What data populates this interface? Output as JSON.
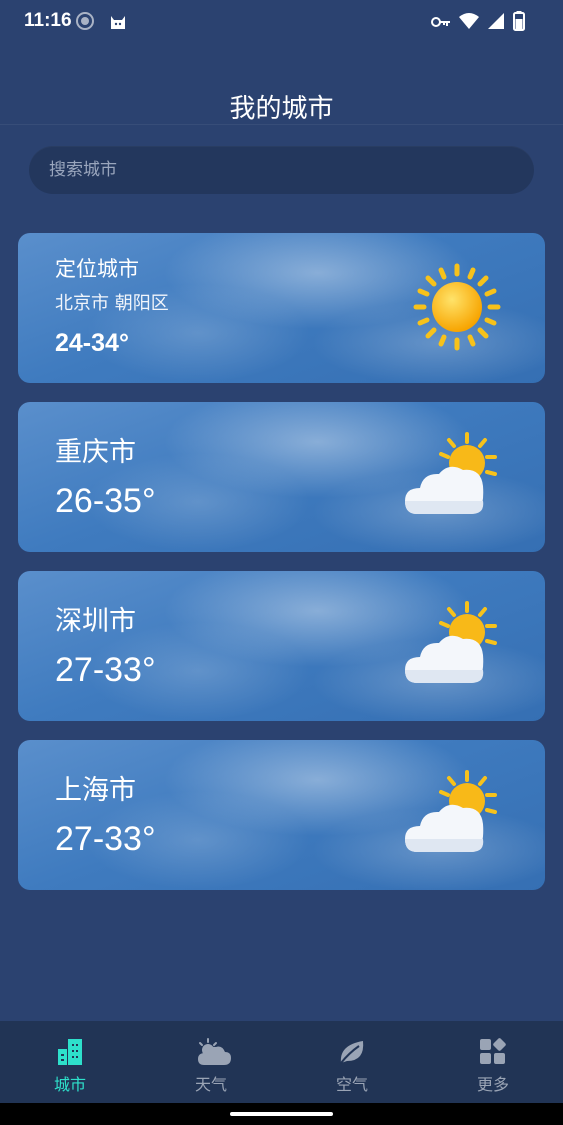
{
  "status_bar": {
    "time": "11:16"
  },
  "page": {
    "title": "我的城市"
  },
  "search": {
    "placeholder": "搜索城市"
  },
  "cards": [
    {
      "name": "定位城市",
      "subtitle": "北京市 朝阳区",
      "temp": "24-34°",
      "icon": "sun-icon"
    },
    {
      "name": "重庆市",
      "temp": "26-35°",
      "icon": "partly-cloudy-icon"
    },
    {
      "name": "深圳市",
      "temp": "27-33°",
      "icon": "partly-cloudy-icon"
    },
    {
      "name": "上海市",
      "temp": "27-33°",
      "icon": "partly-cloudy-icon"
    }
  ],
  "tabs": [
    {
      "label": "城市",
      "icon": "city-icon",
      "active": true
    },
    {
      "label": "天气",
      "icon": "weather-cloud-icon",
      "active": false
    },
    {
      "label": "空气",
      "icon": "leaf-icon",
      "active": false
    },
    {
      "label": "更多",
      "icon": "grid-icon",
      "active": false
    }
  ],
  "colors": {
    "background": "#2b4270",
    "tab_active": "#2ee0cb",
    "tab_inactive": "#9aa4b5"
  }
}
